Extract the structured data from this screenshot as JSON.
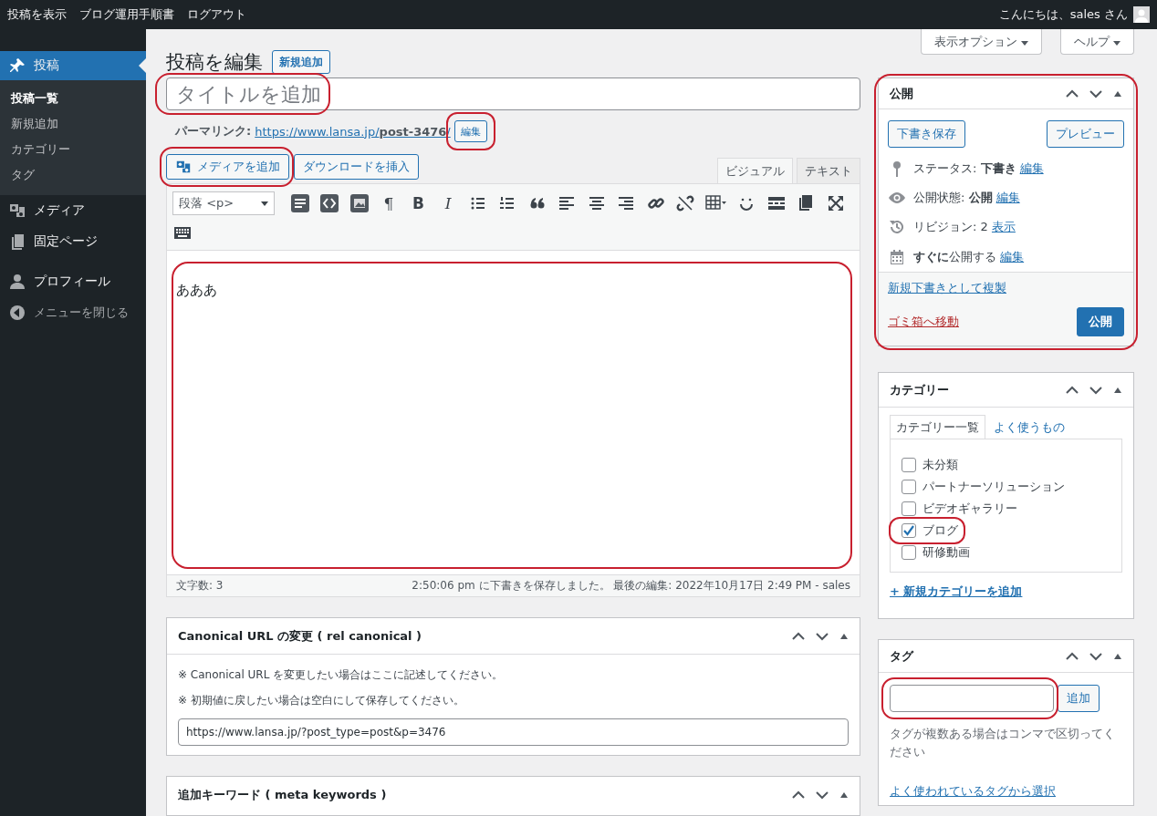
{
  "admin_bar": {
    "left_links": [
      "投稿を表示",
      "ブログ運用手順書",
      "ログアウト"
    ],
    "greeting": "こんにちは、sales さん"
  },
  "sidebar": {
    "items": [
      {
        "label": "投稿",
        "kind": "pin",
        "selected": true,
        "children": [
          {
            "label": "投稿一覧",
            "selected": true
          },
          {
            "label": "新規追加",
            "selected": false
          },
          {
            "label": "カテゴリー",
            "selected": false
          },
          {
            "label": "タグ",
            "selected": false
          }
        ]
      },
      {
        "label": "メディア",
        "kind": "media",
        "selected": false
      },
      {
        "label": "固定ページ",
        "kind": "pages",
        "selected": false
      },
      {
        "label": "プロフィール",
        "kind": "user",
        "selected": false
      },
      {
        "label": "メニューを閉じる",
        "kind": "collapse",
        "selected": false
      }
    ]
  },
  "screen_meta": [
    "表示オプション",
    "ヘルプ"
  ],
  "heading": "投稿を編集",
  "add_new_button": "新規追加",
  "title_field": {
    "placeholder": "タイトルを追加",
    "annotated": true
  },
  "permalink": {
    "label": "パーマリンク:",
    "url": "https://www.lansa.jp/**post-3476**/",
    "edit_button": "編集",
    "annotated": true
  },
  "media_buttons": [
    {
      "label": "メディアを追加",
      "kind": "media",
      "annotated": true
    },
    {
      "label": "ダウンロードを挿入",
      "kind": "plain",
      "annotated": false
    }
  ],
  "editor_tabs": [
    {
      "label": "ビジュアル",
      "selected": true
    },
    {
      "label": "テキスト",
      "selected": false
    }
  ],
  "toolbar": {
    "format": "段落 <p>",
    "rows": [
      [
        {
          "kind": "icon"
        },
        {
          "kind": "icon"
        },
        {
          "kind": "icon"
        },
        {
          "kind": "glyph",
          "text": "¶"
        },
        {
          "kind": "glyph",
          "text": "B"
        },
        {
          "kind": "glyph",
          "text": "I"
        },
        {
          "kind": "icon"
        },
        {
          "kind": "icon"
        },
        {
          "kind": "icon"
        },
        {
          "kind": "icon"
        },
        {
          "kind": "icon"
        },
        {
          "kind": "icon"
        },
        {
          "kind": "icon"
        },
        {
          "kind": "icon"
        },
        {
          "kind": "icon"
        },
        {
          "kind": "icon"
        },
        {
          "kind": "icon"
        },
        {
          "kind": "icon"
        },
        {
          "kind": "icon"
        }
      ],
      [
        {
          "kind": "icon"
        }
      ]
    ]
  },
  "content": {
    "text": "あああ",
    "annotated": true
  },
  "status_bar": {
    "word_count": "文字数: 3",
    "saved": "2:50:06 pm に下書きを保存しました。 最後の編集: 2022年10月17日 2:49 PM - sales"
  },
  "canonical_box": {
    "title": "Canonical URL の変更 ( rel canonical )",
    "notes": [
      "※ Canonical URL を変更したい場合はここに記述してください。",
      "※ 初期値に戻したい場合は空白にして保存してください。"
    ],
    "url_value": "https://www.lansa.jp/?post_type=post&p=3476"
  },
  "keywords_box": {
    "title": "追加キーワード ( meta keywords )"
  },
  "publish_box": {
    "title": "公開",
    "annotated": true,
    "save_draft": "下書き保存",
    "preview": "プレビュー",
    "rows": [
      {
        "kind": "status",
        "text": "ステータス: **下書き**",
        "link": "編集"
      },
      {
        "kind": "visibility",
        "text": "公開状態: **公開**",
        "link": "編集"
      },
      {
        "kind": "revisions",
        "text": "リビジョン: 2",
        "link": "表示"
      },
      {
        "kind": "schedule",
        "text": "**すぐに**公開する",
        "link": "編集"
      }
    ],
    "duplicate_link": "新規下書きとして複製",
    "trash_link": "ゴミ箱へ移動",
    "publish_button": "公開"
  },
  "categories_box": {
    "title": "カテゴリー",
    "tabs": [
      {
        "label": "カテゴリー一覧",
        "selected": true
      },
      {
        "label": "よく使うもの",
        "selected": false
      }
    ],
    "items": [
      {
        "label": "未分類",
        "checked": false,
        "annotated": false
      },
      {
        "label": "パートナーソリューション",
        "checked": false,
        "annotated": false
      },
      {
        "label": "ビデオギャラリー",
        "checked": false,
        "annotated": false
      },
      {
        "label": "ブログ",
        "checked": true,
        "annotated": true
      },
      {
        "label": "研修動画",
        "checked": false,
        "annotated": false
      }
    ],
    "add_link": "+ 新規カテゴリーを追加"
  },
  "tags_box": {
    "title": "タグ",
    "input_annotated": true,
    "add_button": "追加",
    "hint": "タグが複数ある場合はコンマで区切ってください",
    "popular_link": "よく使われているタグから選択"
  }
}
